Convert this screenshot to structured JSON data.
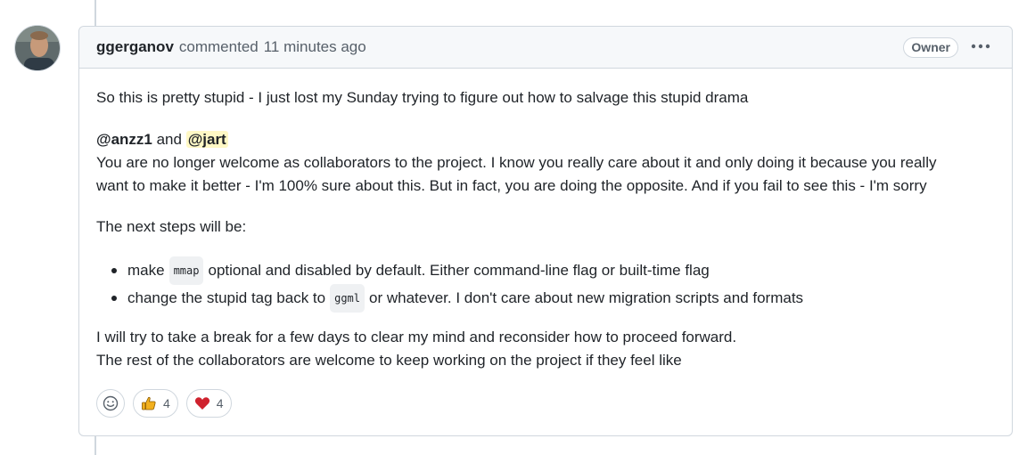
{
  "comment": {
    "author": "ggerganov",
    "action": "commented",
    "time": "11 minutes ago",
    "badge": "Owner",
    "menu_icon": "kebab-horizontal-icon"
  },
  "body": {
    "p1": "So this is pretty stupid - I just lost my Sunday trying to figure out how to salvage this stupid drama",
    "mention1": "@anzz1",
    "and": " and ",
    "mention2": "@jart",
    "line2a": "You are no longer welcome as collaborators to the project. I know you really care about it and only doing it because you really",
    "line2b": "want to make it better - I'm 100% sure about this. But in fact, you are doing the opposite. And if you fail to see this - I'm sorry",
    "p3": "The next steps will be:",
    "list": [
      {
        "pre": "make",
        "code": "mmap",
        "post": "optional and disabled by default. Either command-line flag or built-time flag"
      },
      {
        "pre": "change the stupid tag back to",
        "code": "ggml",
        "post": "or whatever. I don't care about new migration scripts and formats"
      }
    ],
    "p4a": "I will try to take a break for a few days to clear my mind and reconsider how to proceed forward.",
    "p4b": "The rest of the collaborators are welcome to keep working on the project if they feel like"
  },
  "reactions": {
    "picker_icon": "smiley-icon",
    "thumbs_up_count": "4",
    "heart_count": "4"
  },
  "colors": {
    "border": "#d0d7de",
    "header_bg": "#f6f8fa",
    "mention_highlight": "#fff8c5",
    "heart": "#cf222e",
    "thumbs": "#f2b01e"
  }
}
